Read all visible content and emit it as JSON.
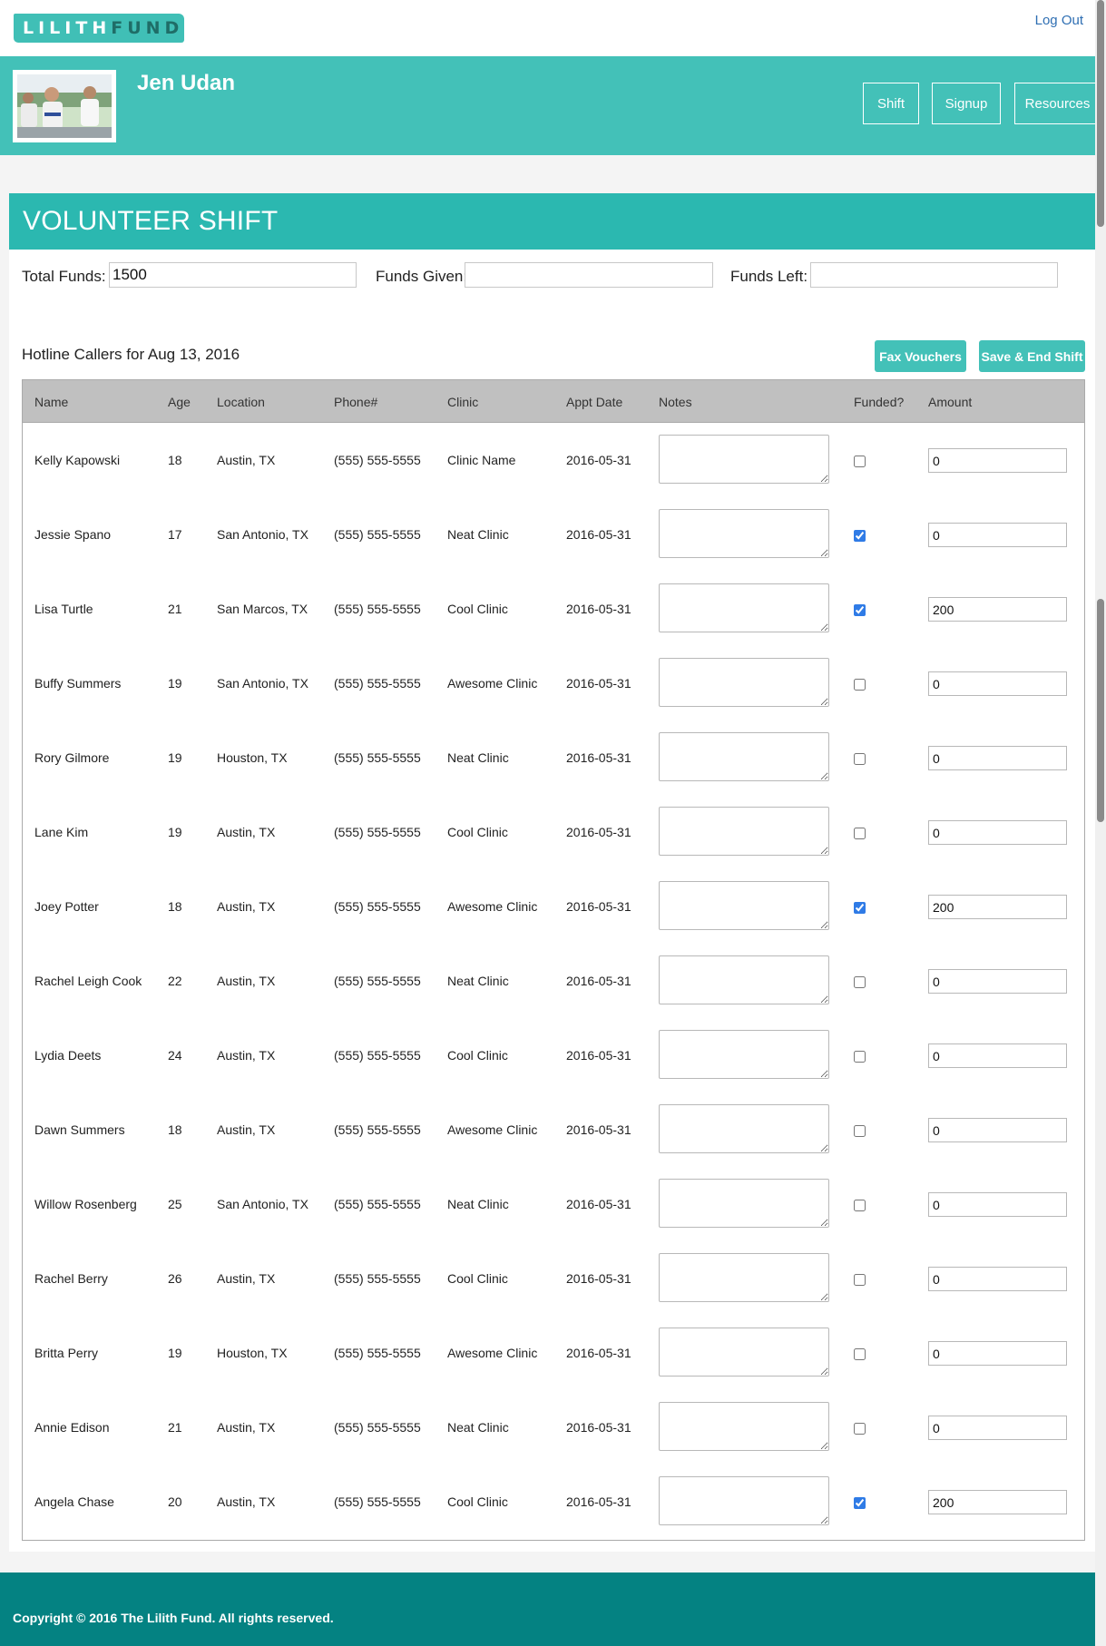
{
  "brand": {
    "logo_part1": "LILITH",
    "logo_part2": "FUND",
    "teal": "#43c1b8",
    "teal_dark": "#2bb8b0",
    "footer_color": "#048282",
    "link_color": "#2f6fb3"
  },
  "header": {
    "logout_label": "Log Out"
  },
  "profile": {
    "name": "Jen Udan",
    "nav": {
      "shift": "Shift",
      "signup": "Signup",
      "resources": "Resources"
    }
  },
  "shift": {
    "title": "VOLUNTEER SHIFT",
    "total_funds_label": "Total Funds:",
    "total_funds_value": "1500",
    "funds_given_label": "Funds Given:",
    "funds_given_value": "",
    "funds_left_label": "Funds Left:",
    "funds_left_value": "",
    "hotline_title": "Hotline Callers for Aug 13, 2016",
    "fax_label": "Fax Vouchers",
    "save_label": "Save & End Shift"
  },
  "table": {
    "columns": [
      "Name",
      "Age",
      "Location",
      "Phone#",
      "Clinic",
      "Appt Date",
      "Notes",
      "Funded?",
      "Amount"
    ],
    "rows": [
      {
        "name": "Kelly Kapowski",
        "age": "18",
        "location": "Austin, TX",
        "phone": "(555) 555-5555",
        "clinic": "Clinic Name",
        "appt": "2016-05-31",
        "notes": "",
        "funded": false,
        "amount": "0"
      },
      {
        "name": "Jessie Spano",
        "age": "17",
        "location": "San Antonio, TX",
        "phone": "(555) 555-5555",
        "clinic": "Neat Clinic",
        "appt": "2016-05-31",
        "notes": "",
        "funded": true,
        "amount": "0"
      },
      {
        "name": "Lisa Turtle",
        "age": "21",
        "location": "San Marcos, TX",
        "phone": "(555) 555-5555",
        "clinic": "Cool Clinic",
        "appt": "2016-05-31",
        "notes": "",
        "funded": true,
        "amount": "200"
      },
      {
        "name": "Buffy Summers",
        "age": "19",
        "location": "San Antonio, TX",
        "phone": "(555) 555-5555",
        "clinic": "Awesome Clinic",
        "appt": "2016-05-31",
        "notes": "",
        "funded": false,
        "amount": "0"
      },
      {
        "name": "Rory Gilmore",
        "age": "19",
        "location": "Houston, TX",
        "phone": "(555) 555-5555",
        "clinic": "Neat Clinic",
        "appt": "2016-05-31",
        "notes": "",
        "funded": false,
        "amount": "0"
      },
      {
        "name": "Lane Kim",
        "age": "19",
        "location": "Austin, TX",
        "phone": "(555) 555-5555",
        "clinic": "Cool Clinic",
        "appt": "2016-05-31",
        "notes": "",
        "funded": false,
        "amount": "0"
      },
      {
        "name": "Joey Potter",
        "age": "18",
        "location": "Austin, TX",
        "phone": "(555) 555-5555",
        "clinic": "Awesome Clinic",
        "appt": "2016-05-31",
        "notes": "",
        "funded": true,
        "amount": "200"
      },
      {
        "name": "Rachel Leigh Cook",
        "age": "22",
        "location": "Austin, TX",
        "phone": "(555) 555-5555",
        "clinic": "Neat Clinic",
        "appt": "2016-05-31",
        "notes": "",
        "funded": false,
        "amount": "0"
      },
      {
        "name": "Lydia Deets",
        "age": "24",
        "location": "Austin, TX",
        "phone": "(555) 555-5555",
        "clinic": "Cool Clinic",
        "appt": "2016-05-31",
        "notes": "",
        "funded": false,
        "amount": "0"
      },
      {
        "name": "Dawn Summers",
        "age": "18",
        "location": "Austin, TX",
        "phone": "(555) 555-5555",
        "clinic": "Awesome Clinic",
        "appt": "2016-05-31",
        "notes": "",
        "funded": false,
        "amount": "0"
      },
      {
        "name": "Willow Rosenberg",
        "age": "25",
        "location": "San Antonio, TX",
        "phone": "(555) 555-5555",
        "clinic": "Neat Clinic",
        "appt": "2016-05-31",
        "notes": "",
        "funded": false,
        "amount": "0"
      },
      {
        "name": "Rachel Berry",
        "age": "26",
        "location": "Austin, TX",
        "phone": "(555) 555-5555",
        "clinic": "Cool Clinic",
        "appt": "2016-05-31",
        "notes": "",
        "funded": false,
        "amount": "0"
      },
      {
        "name": "Britta Perry",
        "age": "19",
        "location": "Houston, TX",
        "phone": "(555) 555-5555",
        "clinic": "Awesome Clinic",
        "appt": "2016-05-31",
        "notes": "",
        "funded": false,
        "amount": "0"
      },
      {
        "name": "Annie Edison",
        "age": "21",
        "location": "Austin, TX",
        "phone": "(555) 555-5555",
        "clinic": "Neat Clinic",
        "appt": "2016-05-31",
        "notes": "",
        "funded": false,
        "amount": "0"
      },
      {
        "name": "Angela Chase",
        "age": "20",
        "location": "Austin, TX",
        "phone": "(555) 555-5555",
        "clinic": "Cool Clinic",
        "appt": "2016-05-31",
        "notes": "",
        "funded": true,
        "amount": "200"
      }
    ]
  },
  "footer": {
    "copyright": "Copyright © 2016 The Lilith Fund. All rights reserved."
  }
}
